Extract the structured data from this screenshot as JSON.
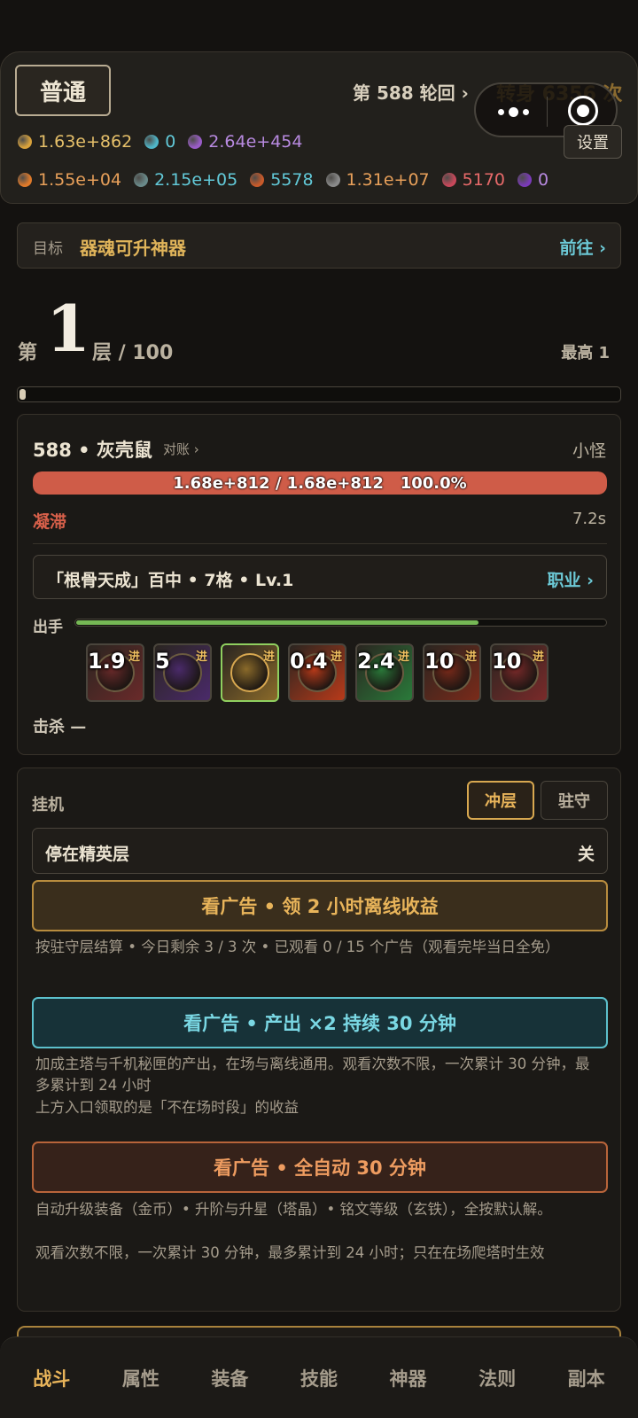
{
  "header": {
    "mode_label": "普通",
    "cycle": "第 588 轮回 ›",
    "rebirth": "转身 6356 次",
    "settings_label": "设置",
    "resources_row1": [
      {
        "icon": "gold-coin-icon",
        "color": "#d8a23c",
        "text": "1.63e+862",
        "text_color": "#e6c06a"
      },
      {
        "icon": "crystal-icon",
        "color": "#4fb6c8",
        "text": "0",
        "text_color": "#62c9d8"
      },
      {
        "icon": "purple-orb-icon",
        "color": "#9a5cc8",
        "text": "2.64e+454",
        "text_color": "#b88ae0"
      }
    ],
    "resources_row2": [
      {
        "icon": "orange-gem-icon",
        "color": "#e07a2a",
        "text": "1.55e+04",
        "text_color": "#e8a05a"
      },
      {
        "icon": "bottle-icon",
        "color": "#6a8a8a",
        "text": "2.15e+05",
        "text_color": "#62c9d8"
      },
      {
        "icon": "ore-icon",
        "color": "#c85a2a",
        "text": "5578",
        "text_color": "#62c9d8"
      },
      {
        "icon": "iron-ingot-icon",
        "color": "#8a8a8a",
        "text": "1.31e+07",
        "text_color": "#e8a05a"
      },
      {
        "icon": "red-seal-icon",
        "color": "#c8485a",
        "text": "5170",
        "text_color": "#e86a6a"
      },
      {
        "icon": "violet-orb-icon",
        "color": "#7a3ab8",
        "text": "0",
        "text_color": "#b88ae0"
      }
    ]
  },
  "target": {
    "label": "目标",
    "value": "器魂可升神器",
    "link": "前往 ›"
  },
  "floor": {
    "prefix": "第",
    "current": "1",
    "suffix": "层 / 100",
    "max_label": "最高 1",
    "progress": 0.01
  },
  "battle": {
    "enemy_name": "588 • 灰壳鼠",
    "reconcile_link": "对账 ›",
    "enemy_type": "小怪",
    "hp_text": "1.68e+812 / 1.68e+812   100.0%",
    "hp_ratio": 1.0,
    "status_label": "凝滞",
    "status_time": "7.2s",
    "class_text": "「根骨天成」百中 • 7格 • Lv.1",
    "class_link": "职业 ›",
    "attack_label": "出手",
    "attack_progress": 0.76,
    "skills": [
      {
        "icon": "blood-wheel-skill-icon",
        "value": "1.9",
        "adv": "进",
        "color": "#6a2a2a",
        "active": false
      },
      {
        "icon": "void-vortex-skill-icon",
        "value": "5",
        "adv": "进",
        "color": "#4a2a6a",
        "active": false
      },
      {
        "icon": "infinity-rune-skill-icon",
        "value": "",
        "adv": "进",
        "color": "#8a6a2a",
        "active": true
      },
      {
        "icon": "fire-orb-skill-icon",
        "value": "0.4",
        "adv": "进",
        "color": "#b83a1a",
        "active": false
      },
      {
        "icon": "jade-swirl-skill-icon",
        "value": "2.4",
        "adv": "进",
        "color": "#2a7a3a",
        "active": false
      },
      {
        "icon": "crimson-beast-skill-icon",
        "value": "10",
        "adv": "进",
        "color": "#7a2a1a",
        "active": false
      },
      {
        "icon": "power-glyph-skill-icon",
        "value": "10",
        "adv": "进",
        "color": "#7a2a2a",
        "active": false
      }
    ],
    "kill_text": "击杀 —"
  },
  "idle": {
    "title": "挂机",
    "tab_push": "冲层",
    "tab_guard": "驻守",
    "stop_label": "停在精英层",
    "stop_value": "关",
    "ad_offline": "看广告 • 领 2 小时离线收益",
    "ad_offline_note": "按驻守层结算 • 今日剩余 3 / 3 次 • 已观看 0 / 15 个广告（观看完毕当日全免）",
    "ad_double": "看广告 • 产出 ×2 持续 30 分钟",
    "ad_double_note1": "加成主塔与千机秘匣的产出，在场与离线通用。观看次数不限，一次累计 30 分钟，最多累计到 24 小时",
    "ad_double_note2": "上方入口领取的是「不在场时段」的收益",
    "ad_auto": "看广告 • 全自动 30 分钟",
    "ad_auto_note1": "自动升级装备（金币）• 升阶与升星（塔晶）• 铭文等级（玄铁），全按默认解。",
    "ad_auto_note2": "观看次数不限，一次累计 30 分钟，最多累计到 24 小时；只在在场爬塔时生效"
  },
  "nav": {
    "items": [
      "战斗",
      "属性",
      "装备",
      "技能",
      "神器",
      "法则",
      "副本"
    ],
    "active": "战斗"
  }
}
